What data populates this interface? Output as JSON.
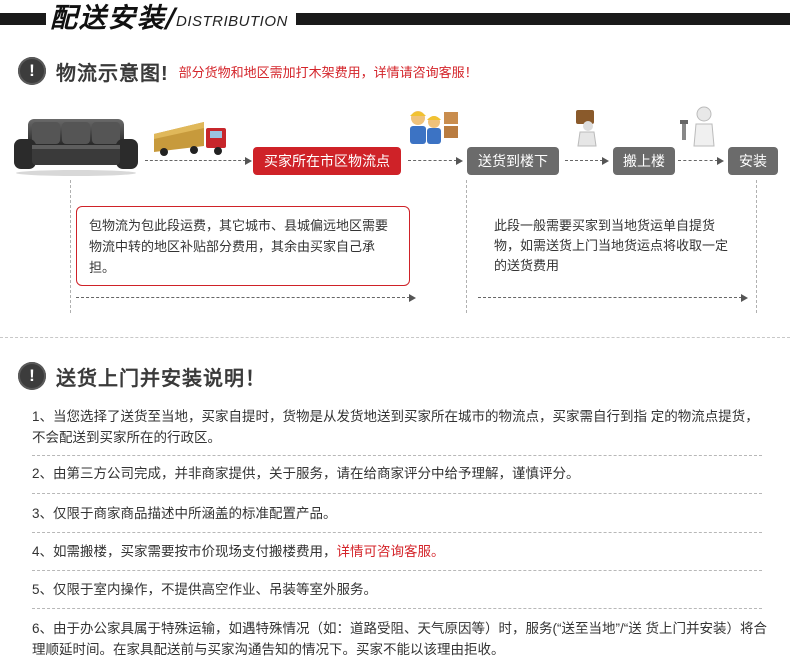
{
  "header": {
    "title": "配送安装",
    "slash": "/",
    "subtitle": "DISTRIBUTION"
  },
  "section1": {
    "icon": "!",
    "title": "物流示意图!",
    "note": "部分货物和地区需加打木架费用，详情请咨询客服！"
  },
  "flow": {
    "steps": [
      {
        "label": "买家所在市区物流点",
        "style": "red"
      },
      {
        "label": "送货到楼下",
        "style": "gray"
      },
      {
        "label": "搬上楼",
        "style": "gray"
      },
      {
        "label": "安装",
        "style": "gray"
      }
    ],
    "left_box_text": "包物流为包此段运费，其它城市、县城偏远地区需要物流中转的地区补贴部分费用，其余由买家自己承担。",
    "right_box_text": "此段一般需要买家到当地货运单自提货物，如需送货上门当地货运点将收取一定的送货费用"
  },
  "section2": {
    "icon": "!",
    "title": "送货上门并安装说明！"
  },
  "notes": [
    {
      "text": "1、当您选择了送货至当地，买家自提时，货物是从发货地送到买家所在城市的物流点，买家需自行到指          定的物流点提货，不会配送到买家所在的行政区。",
      "highlight": ""
    },
    {
      "text": "2、由第三方公司完成，并非商家提供，关于服务，请在给商家评分中给予理解，谨慎评分。",
      "highlight": ""
    },
    {
      "text": "3、仅限于商家商品描述中所涵盖的标准配置产品。",
      "highlight": ""
    },
    {
      "text": "4、如需搬楼，买家需要按市价现场支付搬楼费用，",
      "highlight": "详情可咨询客服。"
    },
    {
      "text": "5、仅限于室内操作，不提供高空作业、吊装等室外服务。",
      "highlight": ""
    },
    {
      "text": "6、由于办公家具属于特殊运输，如遇特殊情况（如：道路受阻、天气原因等）时，服务(“送至当地”/“送      货上门并安装）将合理顺延时间。在家具配送前与买家沟通告知的情况下。买家不能以该理由拒收。",
      "highlight": ""
    }
  ],
  "colors": {
    "accent_red": "#cf2228",
    "step_gray": "#6b6b6b",
    "banner_black": "#1a1a1a"
  }
}
